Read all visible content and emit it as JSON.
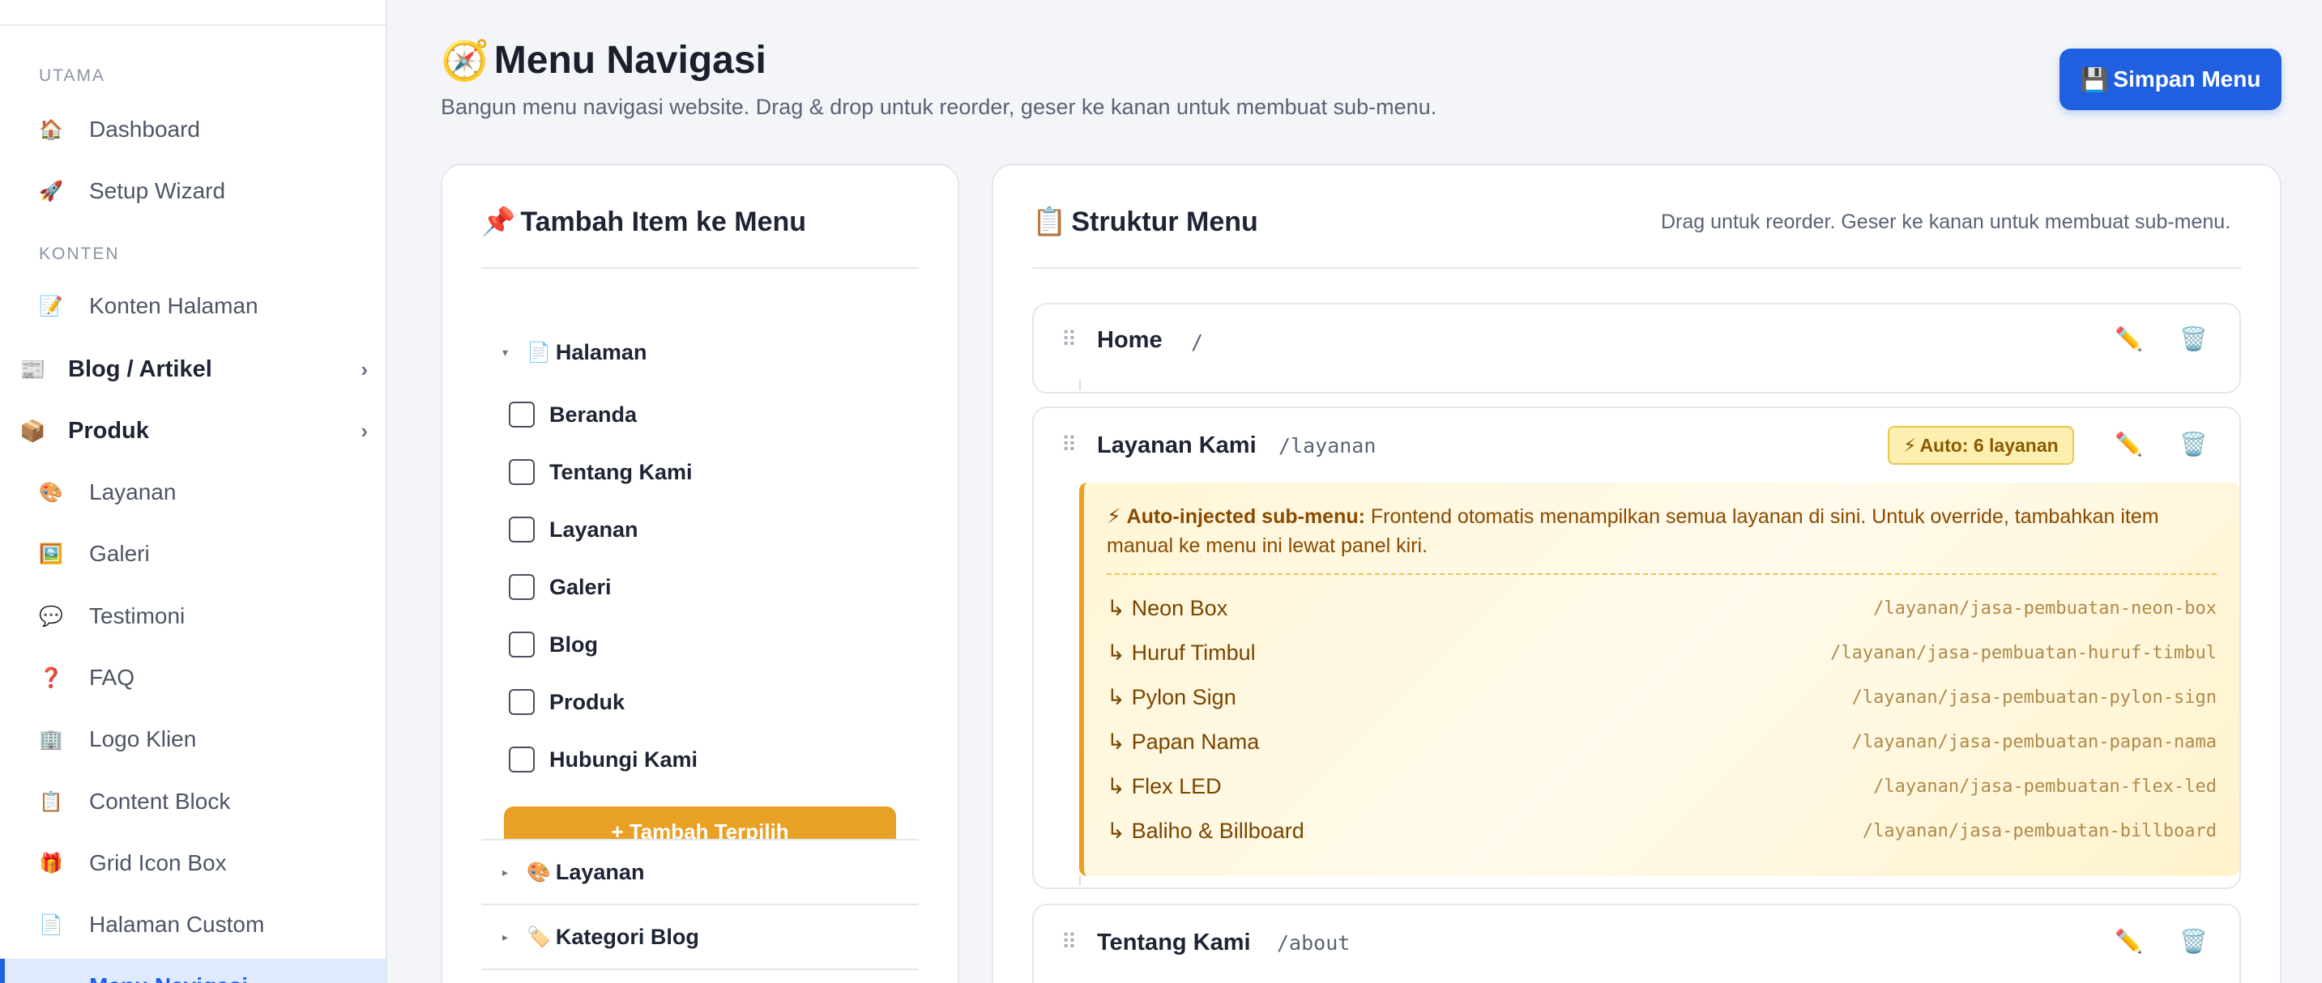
{
  "sidebar": {
    "sections": {
      "utama": "UTAMA",
      "konten": "KONTEN"
    },
    "items": [
      {
        "label": "Dashboard",
        "icon": "🏠"
      },
      {
        "label": "Setup Wizard",
        "icon": "🚀"
      },
      {
        "label": "Konten Halaman",
        "icon": "📝"
      },
      {
        "label": "Blog / Artikel",
        "icon": "📰"
      },
      {
        "label": "Produk",
        "icon": "📦"
      },
      {
        "label": "Layanan",
        "icon": "🎨"
      },
      {
        "label": "Galeri",
        "icon": "🖼️"
      },
      {
        "label": "Testimoni",
        "icon": "💬"
      },
      {
        "label": "FAQ",
        "icon": "❓"
      },
      {
        "label": "Logo Klien",
        "icon": "🏢"
      },
      {
        "label": "Content Block",
        "icon": "📋"
      },
      {
        "label": "Grid Icon Box",
        "icon": "🎁"
      },
      {
        "label": "Halaman Custom",
        "icon": "📄"
      },
      {
        "label": "Menu Navigasi",
        "icon": "🧭"
      }
    ],
    "chevron": "›"
  },
  "header": {
    "icon": "🧭",
    "title": "Menu Navigasi",
    "subtitle": "Bangun menu navigasi website. Drag & drop untuk reorder, geser ke kanan untuk membuat sub-menu.",
    "save_icon": "💾",
    "save_label": "Simpan Menu"
  },
  "left_panel": {
    "icon": "📌",
    "title": "Tambah Item ke Menu",
    "group_pages": {
      "icon": "📄",
      "label": "Halaman",
      "arrow": "▾"
    },
    "pages": [
      "Beranda",
      "Tentang Kami",
      "Layanan",
      "Galeri",
      "Blog",
      "Produk",
      "Hubungi Kami"
    ],
    "add_button": "+ Tambah Terpilih",
    "group_services": {
      "icon": "🎨",
      "label": "Layanan",
      "arrow": "▸"
    },
    "group_blog_categories": {
      "icon": "🏷️",
      "label": "Kategori Blog",
      "arrow": "▸"
    }
  },
  "right_panel": {
    "icon": "📋",
    "title": "Struktur Menu",
    "hint": "Drag untuk reorder. Geser ke kanan untuk membuat sub-menu.",
    "drag_glyph": "⠿",
    "edit_icon": "✏️",
    "delete_icon": "🗑️",
    "items": [
      {
        "label": "Home",
        "url": "/"
      },
      {
        "label": "Layanan Kami",
        "url": "/layanan",
        "badge": "Auto: 6 layanan",
        "badge_icon": "⚡"
      },
      {
        "label": "Tentang Kami",
        "url": "/about"
      }
    ],
    "auto_injected": {
      "icon": "⚡",
      "title": "Auto-injected sub-menu:",
      "text": "Frontend otomatis menampilkan semua layanan di sini. Untuk override, tambahkan item manual ke menu ini lewat panel kiri.",
      "arrow": "↳",
      "subitems": [
        {
          "label": "Neon Box",
          "url": "/layanan/jasa-pembuatan-neon-box"
        },
        {
          "label": "Huruf Timbul",
          "url": "/layanan/jasa-pembuatan-huruf-timbul"
        },
        {
          "label": "Pylon Sign",
          "url": "/layanan/jasa-pembuatan-pylon-sign"
        },
        {
          "label": "Papan Nama",
          "url": "/layanan/jasa-pembuatan-papan-nama"
        },
        {
          "label": "Flex LED",
          "url": "/layanan/jasa-pembuatan-flex-led"
        },
        {
          "label": "Baliho & Billboard",
          "url": "/layanan/jasa-pembuatan-billboard"
        }
      ]
    }
  },
  "colors": {
    "primary": "#1f5fe0",
    "accent_orange": "#e9a125",
    "auto_bg": "#fff6d6"
  }
}
